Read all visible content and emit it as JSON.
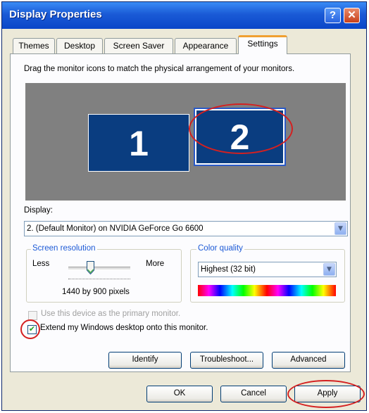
{
  "window": {
    "title": "Display Properties",
    "help_label": "?",
    "close_label": "✕"
  },
  "tabs": [
    {
      "label": "Themes"
    },
    {
      "label": "Desktop"
    },
    {
      "label": "Screen Saver"
    },
    {
      "label": "Appearance"
    },
    {
      "label": "Settings"
    }
  ],
  "active_tab": "Settings",
  "settings": {
    "instruction": "Drag the monitor icons to match the physical arrangement of your monitors.",
    "monitors": [
      {
        "number": "1"
      },
      {
        "number": "2"
      }
    ],
    "display_label": "Display:",
    "display_value": "2. (Default Monitor) on NVIDIA GeForce Go 6600",
    "screen_resolution": {
      "legend": "Screen resolution",
      "less_label": "Less",
      "more_label": "More",
      "value": "1440 by 900 pixels"
    },
    "color_quality": {
      "legend": "Color quality",
      "value": "Highest (32 bit)"
    },
    "primary_checkbox": {
      "label": "Use this device as the primary monitor.",
      "checked": false,
      "enabled": false
    },
    "extend_checkbox": {
      "label": "Extend my Windows desktop onto this monitor.",
      "checked": true,
      "check_mark": "✔"
    },
    "buttons": {
      "identify": "Identify",
      "troubleshoot": "Troubleshoot...",
      "advanced": "Advanced"
    }
  },
  "footer": {
    "ok": "OK",
    "cancel": "Cancel",
    "apply": "Apply"
  },
  "colors": {
    "title_bar": "#0a46c8",
    "monitor_fill": "#0a3d80",
    "annotation_circle": "#d42020"
  }
}
